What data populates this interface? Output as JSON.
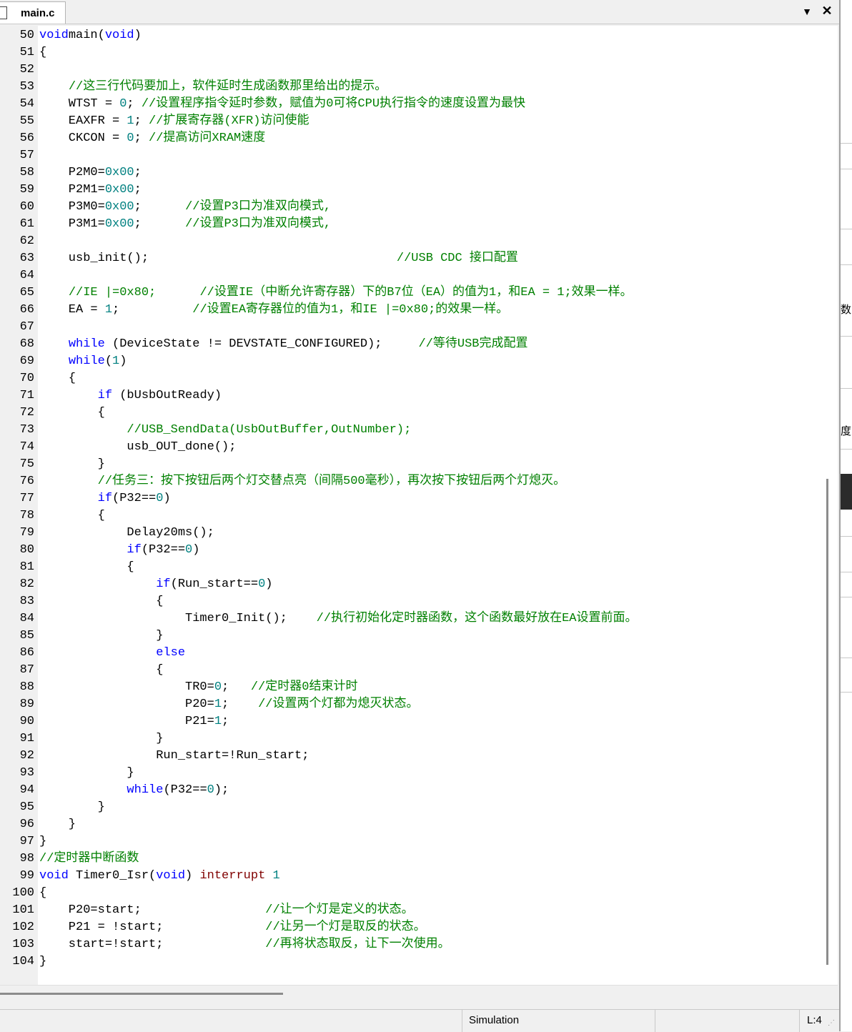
{
  "tab": {
    "label": "main.c"
  },
  "icons": {
    "dropdown": "▼",
    "close": "✕",
    "file": "file-icon"
  },
  "status": {
    "mode": "Simulation",
    "line": "L:4"
  },
  "side_panel": {
    "glyphs": [
      "数",
      "度"
    ]
  },
  "colors": {
    "keyword": "#0000ff",
    "number": "#008080",
    "comment": "#008000",
    "interrupt": "#800000"
  },
  "lines": [
    {
      "n": "50",
      "t": [
        [
          "kw",
          "void"
        ],
        [
          "",
          "main"
        ],
        [
          "",
          "("
        ],
        [
          "kw",
          "void"
        ],
        [
          "",
          ")"
        ]
      ]
    },
    {
      "n": "51",
      "t": [
        [
          "",
          "{"
        ]
      ]
    },
    {
      "n": "52",
      "t": []
    },
    {
      "n": "53",
      "t": [
        [
          "",
          "    "
        ],
        [
          "cm",
          "//这三行代码要加上，软件延时生成函数那里给出的提示。"
        ]
      ]
    },
    {
      "n": "54",
      "t": [
        [
          "",
          "    WTST = "
        ],
        [
          "num",
          "0"
        ],
        [
          "",
          "; "
        ],
        [
          "cm",
          "//设置程序指令延时参数，赋值为0可将CPU执行指令的速度设置为最快"
        ]
      ]
    },
    {
      "n": "55",
      "t": [
        [
          "",
          "    EAXFR = "
        ],
        [
          "num",
          "1"
        ],
        [
          "",
          "; "
        ],
        [
          "cm",
          "//扩展寄存器(XFR)访问使能"
        ]
      ]
    },
    {
      "n": "56",
      "t": [
        [
          "",
          "    CKCON = "
        ],
        [
          "num",
          "0"
        ],
        [
          "",
          "; "
        ],
        [
          "cm",
          "//提高访问XRAM速度"
        ]
      ]
    },
    {
      "n": "57",
      "t": []
    },
    {
      "n": "58",
      "t": [
        [
          "",
          "    P2M0="
        ],
        [
          "num",
          "0x00"
        ],
        [
          "",
          ";"
        ]
      ]
    },
    {
      "n": "59",
      "t": [
        [
          "",
          "    P2M1="
        ],
        [
          "num",
          "0x00"
        ],
        [
          "",
          ";"
        ]
      ]
    },
    {
      "n": "60",
      "t": [
        [
          "",
          "    P3M0="
        ],
        [
          "num",
          "0x00"
        ],
        [
          "",
          ";      "
        ],
        [
          "cm",
          "//设置P3口为准双向模式,"
        ]
      ]
    },
    {
      "n": "61",
      "t": [
        [
          "",
          "    P3M1="
        ],
        [
          "num",
          "0x00"
        ],
        [
          "",
          ";      "
        ],
        [
          "cm",
          "//设置P3口为准双向模式,"
        ]
      ]
    },
    {
      "n": "62",
      "t": []
    },
    {
      "n": "63",
      "t": [
        [
          "",
          "    usb_init();                                  "
        ],
        [
          "cm",
          "//USB CDC 接口配置"
        ]
      ]
    },
    {
      "n": "64",
      "t": []
    },
    {
      "n": "65",
      "t": [
        [
          "",
          "    "
        ],
        [
          "cm",
          "//IE |=0x80;      //设置IE（中断允许寄存器）下的B7位（EA）的值为1，和EA = 1;效果一样。"
        ]
      ]
    },
    {
      "n": "66",
      "t": [
        [
          "",
          "    EA = "
        ],
        [
          "num",
          "1"
        ],
        [
          "",
          ";          "
        ],
        [
          "cm",
          "//设置EA寄存器位的值为1，和IE |=0x80;的效果一样。"
        ]
      ]
    },
    {
      "n": "67",
      "t": []
    },
    {
      "n": "68",
      "t": [
        [
          "",
          "    "
        ],
        [
          "kw",
          "while"
        ],
        [
          "",
          " (DeviceState != DEVSTATE_CONFIGURED);     "
        ],
        [
          "cm",
          "//等待USB完成配置"
        ]
      ]
    },
    {
      "n": "69",
      "t": [
        [
          "",
          "    "
        ],
        [
          "kw",
          "while"
        ],
        [
          "",
          "("
        ],
        [
          "num",
          "1"
        ],
        [
          "",
          ")"
        ]
      ]
    },
    {
      "n": "70",
      "t": [
        [
          "",
          "    {"
        ]
      ]
    },
    {
      "n": "71",
      "t": [
        [
          "",
          "        "
        ],
        [
          "kw",
          "if"
        ],
        [
          "",
          " (bUsbOutReady)"
        ]
      ]
    },
    {
      "n": "72",
      "t": [
        [
          "",
          "        {"
        ]
      ]
    },
    {
      "n": "73",
      "t": [
        [
          "",
          "            "
        ],
        [
          "cm",
          "//USB_SendData(UsbOutBuffer,OutNumber);"
        ]
      ]
    },
    {
      "n": "74",
      "t": [
        [
          "",
          "            usb_OUT_done();"
        ]
      ]
    },
    {
      "n": "75",
      "t": [
        [
          "",
          "        }"
        ]
      ]
    },
    {
      "n": "76",
      "t": [
        [
          "",
          "        "
        ],
        [
          "cm",
          "//任务三：按下按钮后两个灯交替点亮（间隔500毫秒），再次按下按钮后两个灯熄灭。"
        ]
      ]
    },
    {
      "n": "77",
      "t": [
        [
          "",
          "        "
        ],
        [
          "kw",
          "if"
        ],
        [
          "",
          "(P32=="
        ],
        [
          "num",
          "0"
        ],
        [
          "",
          ")"
        ]
      ]
    },
    {
      "n": "78",
      "t": [
        [
          "",
          "        {"
        ]
      ]
    },
    {
      "n": "79",
      "t": [
        [
          "",
          "            Delay20ms();"
        ]
      ]
    },
    {
      "n": "80",
      "t": [
        [
          "",
          "            "
        ],
        [
          "kw",
          "if"
        ],
        [
          "",
          "(P32=="
        ],
        [
          "num",
          "0"
        ],
        [
          "",
          ")"
        ]
      ]
    },
    {
      "n": "81",
      "t": [
        [
          "",
          "            {"
        ]
      ]
    },
    {
      "n": "82",
      "t": [
        [
          "",
          "                "
        ],
        [
          "kw",
          "if"
        ],
        [
          "",
          "(Run_start=="
        ],
        [
          "num",
          "0"
        ],
        [
          "",
          ")"
        ]
      ]
    },
    {
      "n": "83",
      "t": [
        [
          "",
          "                {"
        ]
      ]
    },
    {
      "n": "84",
      "t": [
        [
          "",
          "                    Timer0_Init();    "
        ],
        [
          "cm",
          "//执行初始化定时器函数，这个函数最好放在EA设置前面。"
        ]
      ]
    },
    {
      "n": "85",
      "t": [
        [
          "",
          "                }"
        ]
      ]
    },
    {
      "n": "86",
      "t": [
        [
          "",
          "                "
        ],
        [
          "kw",
          "else"
        ]
      ]
    },
    {
      "n": "87",
      "t": [
        [
          "",
          "                {"
        ]
      ]
    },
    {
      "n": "88",
      "t": [
        [
          "",
          "                    TR0="
        ],
        [
          "num",
          "0"
        ],
        [
          "",
          ";   "
        ],
        [
          "cm",
          "//定时器0结束计时"
        ]
      ]
    },
    {
      "n": "89",
      "t": [
        [
          "",
          "                    P20="
        ],
        [
          "num",
          "1"
        ],
        [
          "",
          ";    "
        ],
        [
          "cm",
          "//设置两个灯都为熄灭状态。"
        ]
      ]
    },
    {
      "n": "90",
      "t": [
        [
          "",
          "                    P21="
        ],
        [
          "num",
          "1"
        ],
        [
          "",
          ";"
        ]
      ]
    },
    {
      "n": "91",
      "t": [
        [
          "",
          "                }"
        ]
      ]
    },
    {
      "n": "92",
      "t": [
        [
          "",
          "                Run_start=!Run_start;"
        ]
      ]
    },
    {
      "n": "93",
      "t": [
        [
          "",
          "            }"
        ]
      ]
    },
    {
      "n": "94",
      "t": [
        [
          "",
          "            "
        ],
        [
          "kw",
          "while"
        ],
        [
          "",
          "(P32=="
        ],
        [
          "num",
          "0"
        ],
        [
          "",
          ");"
        ]
      ]
    },
    {
      "n": "95",
      "t": [
        [
          "",
          "        }"
        ]
      ]
    },
    {
      "n": "96",
      "t": [
        [
          "",
          "    }"
        ]
      ]
    },
    {
      "n": "97",
      "t": [
        [
          "",
          "}"
        ]
      ]
    },
    {
      "n": "98",
      "t": [
        [
          "cm",
          "//定时器中断函数"
        ]
      ]
    },
    {
      "n": "99",
      "t": [
        [
          "kw",
          "void"
        ],
        [
          "",
          " Timer0_Isr("
        ],
        [
          "kw",
          "void"
        ],
        [
          "",
          ") "
        ],
        [
          "int",
          "interrupt"
        ],
        [
          "",
          " "
        ],
        [
          "num",
          "1"
        ]
      ]
    },
    {
      "n": "100",
      "t": [
        [
          "",
          "{"
        ]
      ]
    },
    {
      "n": "101",
      "t": [
        [
          "",
          "    P20=start;                 "
        ],
        [
          "cm",
          "//让一个灯是定义的状态。"
        ]
      ]
    },
    {
      "n": "102",
      "t": [
        [
          "",
          "    P21 = !start;              "
        ],
        [
          "cm",
          "//让另一个灯是取反的状态。"
        ]
      ]
    },
    {
      "n": "103",
      "t": [
        [
          "",
          "    start=!start;              "
        ],
        [
          "cm",
          "//再将状态取反，让下一次使用。"
        ]
      ]
    },
    {
      "n": "104",
      "t": [
        [
          "",
          "}"
        ]
      ]
    }
  ]
}
